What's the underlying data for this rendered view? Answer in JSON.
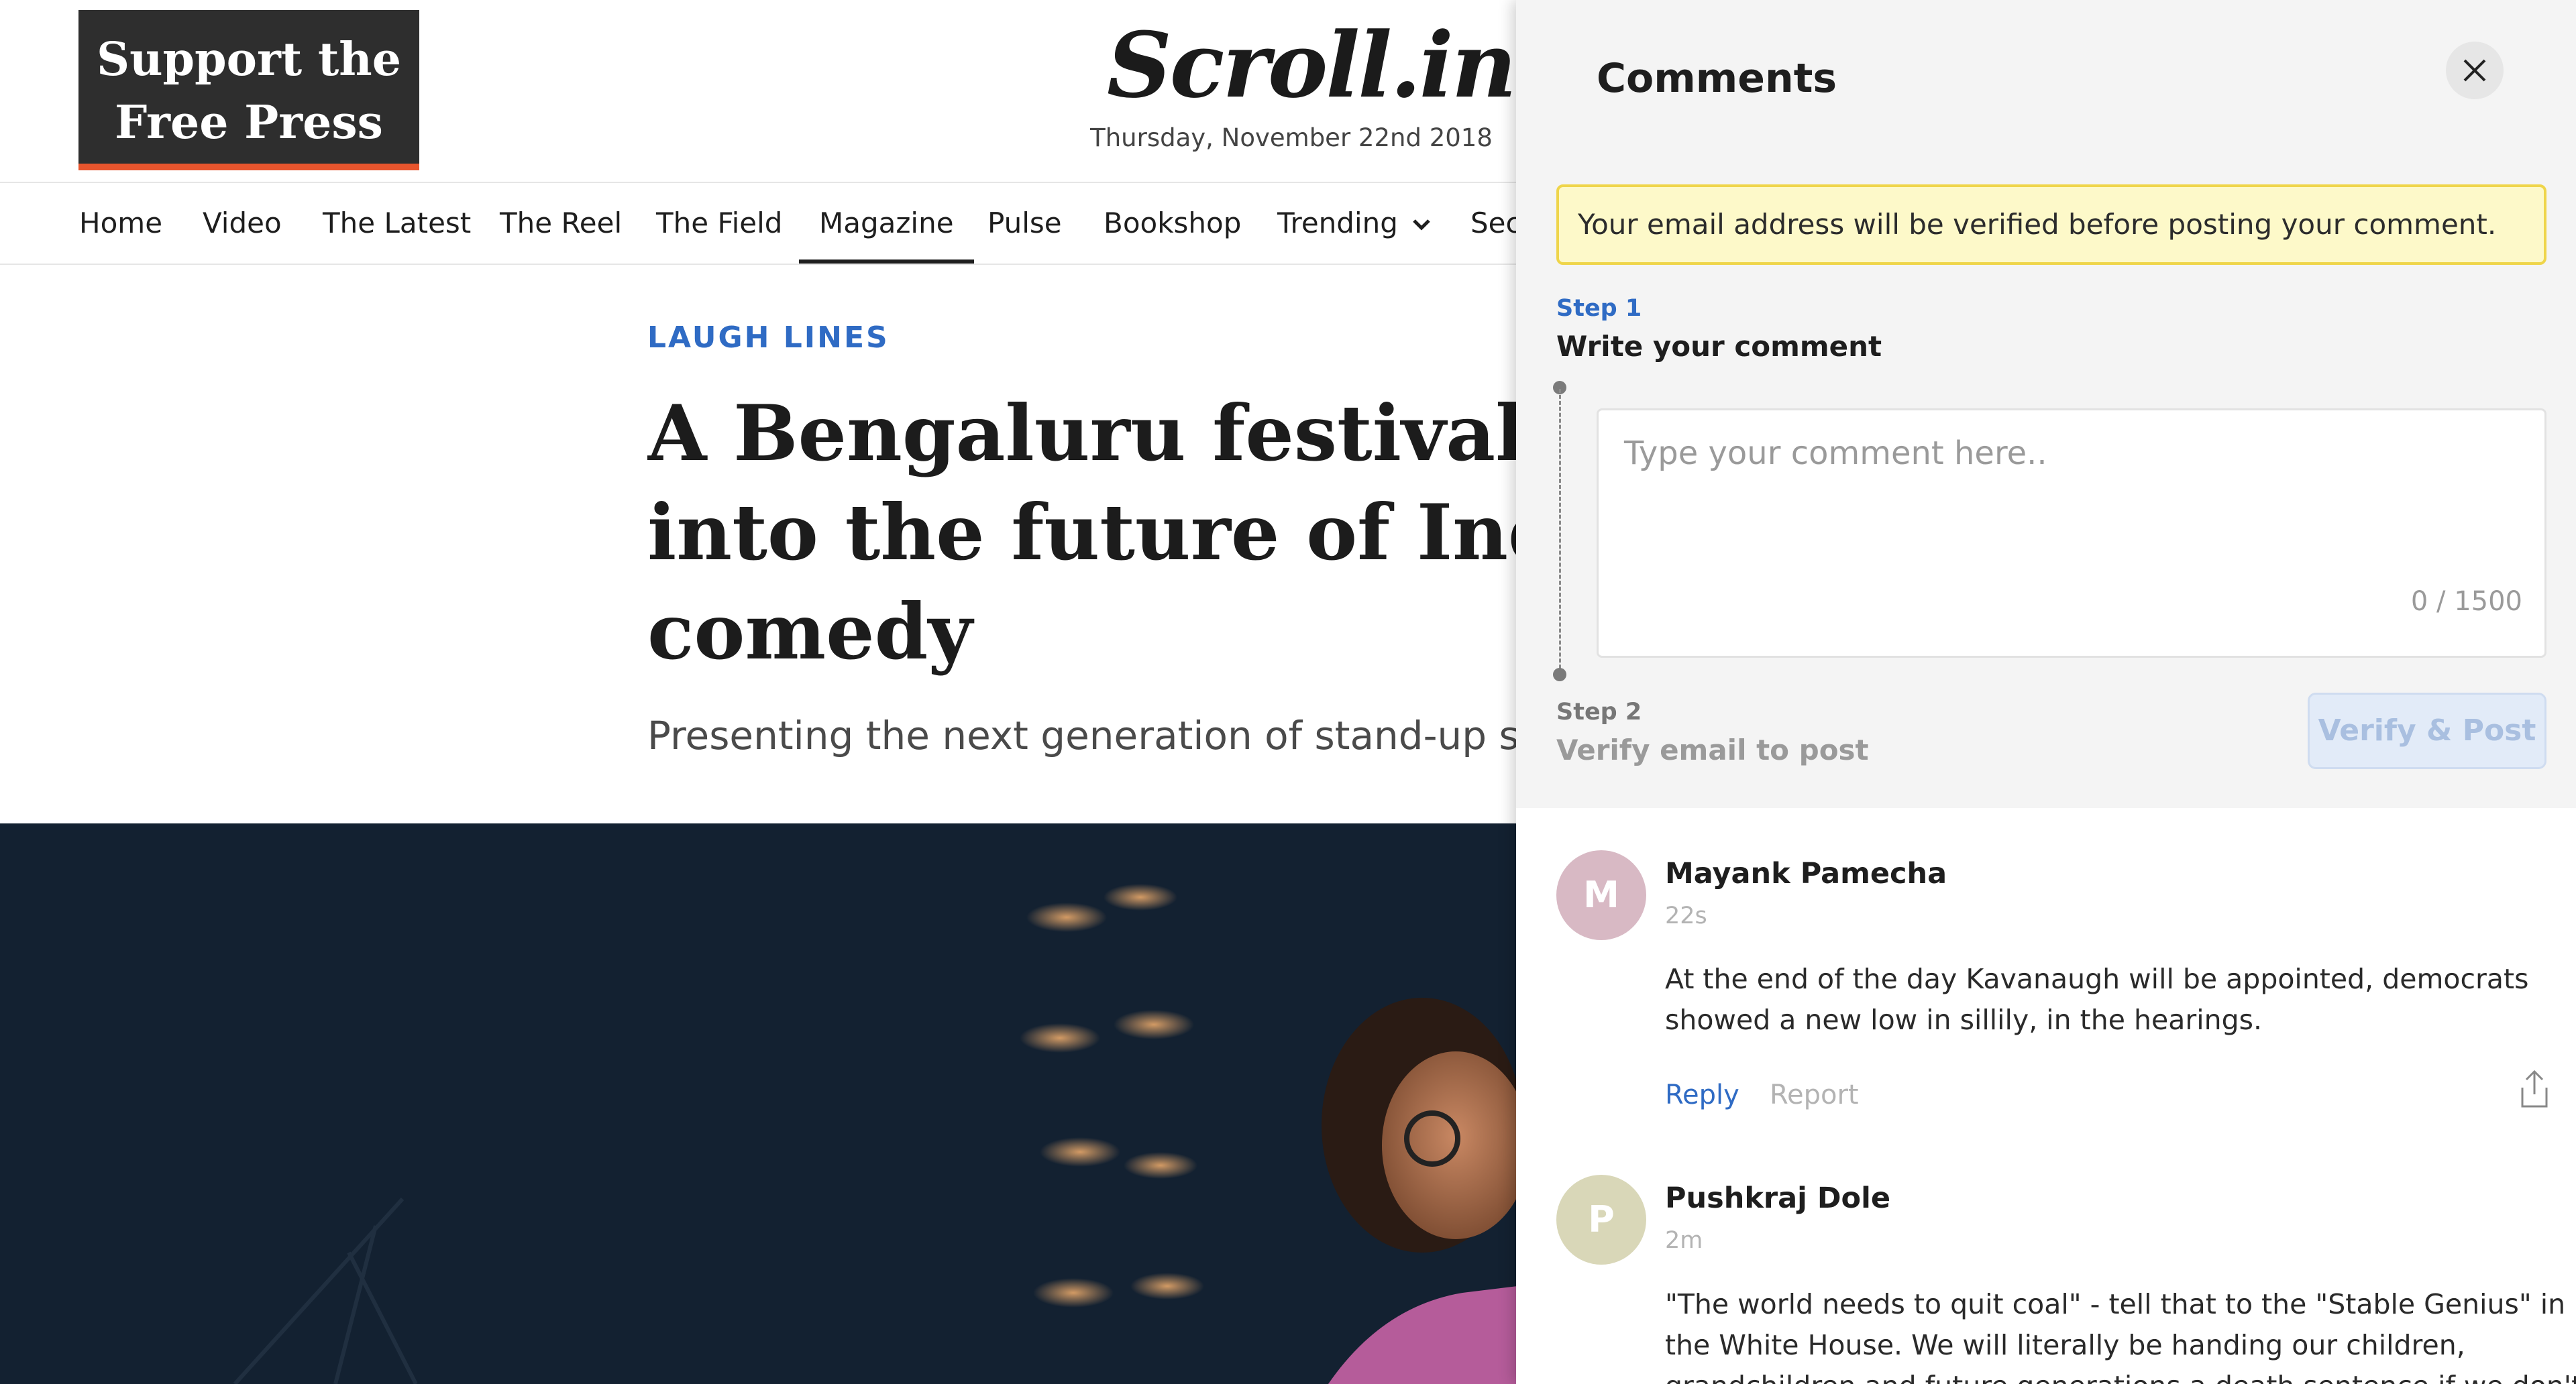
{
  "support": {
    "line1": "Support the",
    "line2": "Free Press"
  },
  "masthead": {
    "logo": "Scroll.in",
    "date": "Thursday, November 22nd 2018"
  },
  "nav": {
    "items": [
      "Home",
      "Video",
      "The Latest",
      "The Reel",
      "The Field",
      "Magazine",
      "Pulse",
      "Bookshop",
      "Trending",
      "Sec"
    ],
    "active": "Magazine",
    "dropdown_icon": "chevron-down-icon"
  },
  "article": {
    "kicker": "LAUGH LINES",
    "headline": "A Bengaluru festival give\ninto the future of Indian s\ncomedy",
    "subhead": "Presenting the next generation of stand-up sta"
  },
  "comments": {
    "title": "Comments",
    "close_icon": "close-icon",
    "notice": "Your email address will be verified before posting your comment.",
    "step1": {
      "label": "Step 1",
      "title": "Write your comment"
    },
    "input": {
      "placeholder": "Type your comment here..",
      "value": "",
      "counter": "0 / 1500"
    },
    "step2": {
      "label": "Step 2",
      "title": "Verify email to post"
    },
    "verify_button": "Verify & Post",
    "list": [
      {
        "initial": "M",
        "author": "Mayank Pamecha",
        "time": "22s",
        "text": "At the end of the day Kavanaugh will be appointed, democrats showed a new low in sillily, in the hearings.",
        "reply": "Reply",
        "report": "Report",
        "avatar_color": "#d8b9c4"
      },
      {
        "initial": "P",
        "author": "Pushkraj Dole",
        "time": "2m",
        "text": "\"The world needs to quit coal\" - tell that to the \"Stable Genius\" in the White House. We will literally be handing our children, grandchildren and future generations a death sentence if we don't stop putting",
        "avatar_color": "#d9d7b8"
      }
    ],
    "share_icon": "share-icon"
  },
  "colors": {
    "accent_blue": "#2f6bc4",
    "support_bar": "#e8552d",
    "notice_bg": "#fdf9c9",
    "notice_border": "#efd54a"
  }
}
